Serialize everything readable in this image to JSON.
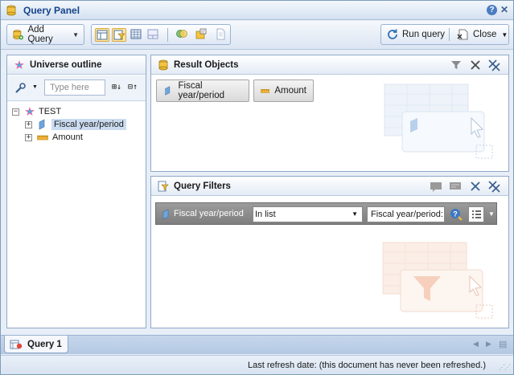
{
  "window": {
    "title": "Query Panel",
    "help_glyph": "?",
    "close_glyph": "✕"
  },
  "toolbar": {
    "add_query_label": "Add Query",
    "run_query_label": "Run query",
    "close_label": "Close"
  },
  "outline": {
    "title": "Universe outline",
    "search_placeholder": "Type here",
    "tree": [
      {
        "label": "TEST",
        "expander": "−",
        "icon": "universe-icon"
      },
      {
        "label": "Fiscal year/period",
        "expander": "+",
        "icon": "dimension-icon",
        "selected": true
      },
      {
        "label": "Amount",
        "expander": "+",
        "icon": "measure-icon"
      }
    ]
  },
  "result_objects": {
    "title": "Result Objects",
    "items": [
      {
        "label": "Fiscal year/period",
        "icon": "dimension-icon"
      },
      {
        "label": "Amount",
        "icon": "measure-icon"
      }
    ]
  },
  "query_filters": {
    "title": "Query Filters",
    "filter": {
      "object": "Fiscal year/period",
      "operator": "In list",
      "operand": "Fiscal year/period:"
    }
  },
  "tabs": [
    {
      "label": "Query 1",
      "active": true
    }
  ],
  "status": {
    "last_refresh": "Last refresh date: (this document has never been refreshed.)"
  },
  "colors": {
    "accent": "#15428b",
    "selection": "#cbdcf0",
    "filter_bar": "#8a8a8a",
    "toolbar_active": "#ffe7a2"
  }
}
